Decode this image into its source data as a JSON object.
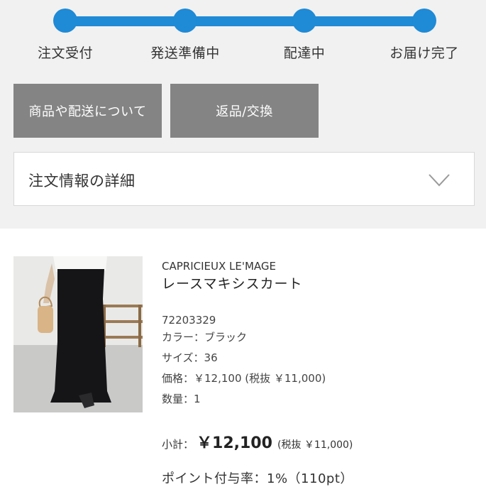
{
  "progress": {
    "steps": [
      "注文受付",
      "発送準備中",
      "配達中",
      "お届け完了"
    ],
    "accent_color": "#1f8ad6",
    "current_step": 4
  },
  "buttons": {
    "product_delivery": "商品や配送について",
    "return_exchange": "返品/交換"
  },
  "order_details": {
    "title": "注文情報の詳細",
    "icon": "chevron-down-icon"
  },
  "product": {
    "brand": "CAPRICIEUX LE'MAGE",
    "name": "レースマキシスカート",
    "item_number": "72203329",
    "color": "カラー：ブラック",
    "size": "サイズ：36",
    "price": "価格：￥12,100 (税抜 ￥11,000)",
    "quantity": "数量：1"
  },
  "summary": {
    "subtotal_label": "小計：",
    "subtotal_amount": "￥12,100",
    "subtotal_tax": "(税抜 ￥11,000)",
    "points": "ポイント付与率：1%（110pt）"
  }
}
